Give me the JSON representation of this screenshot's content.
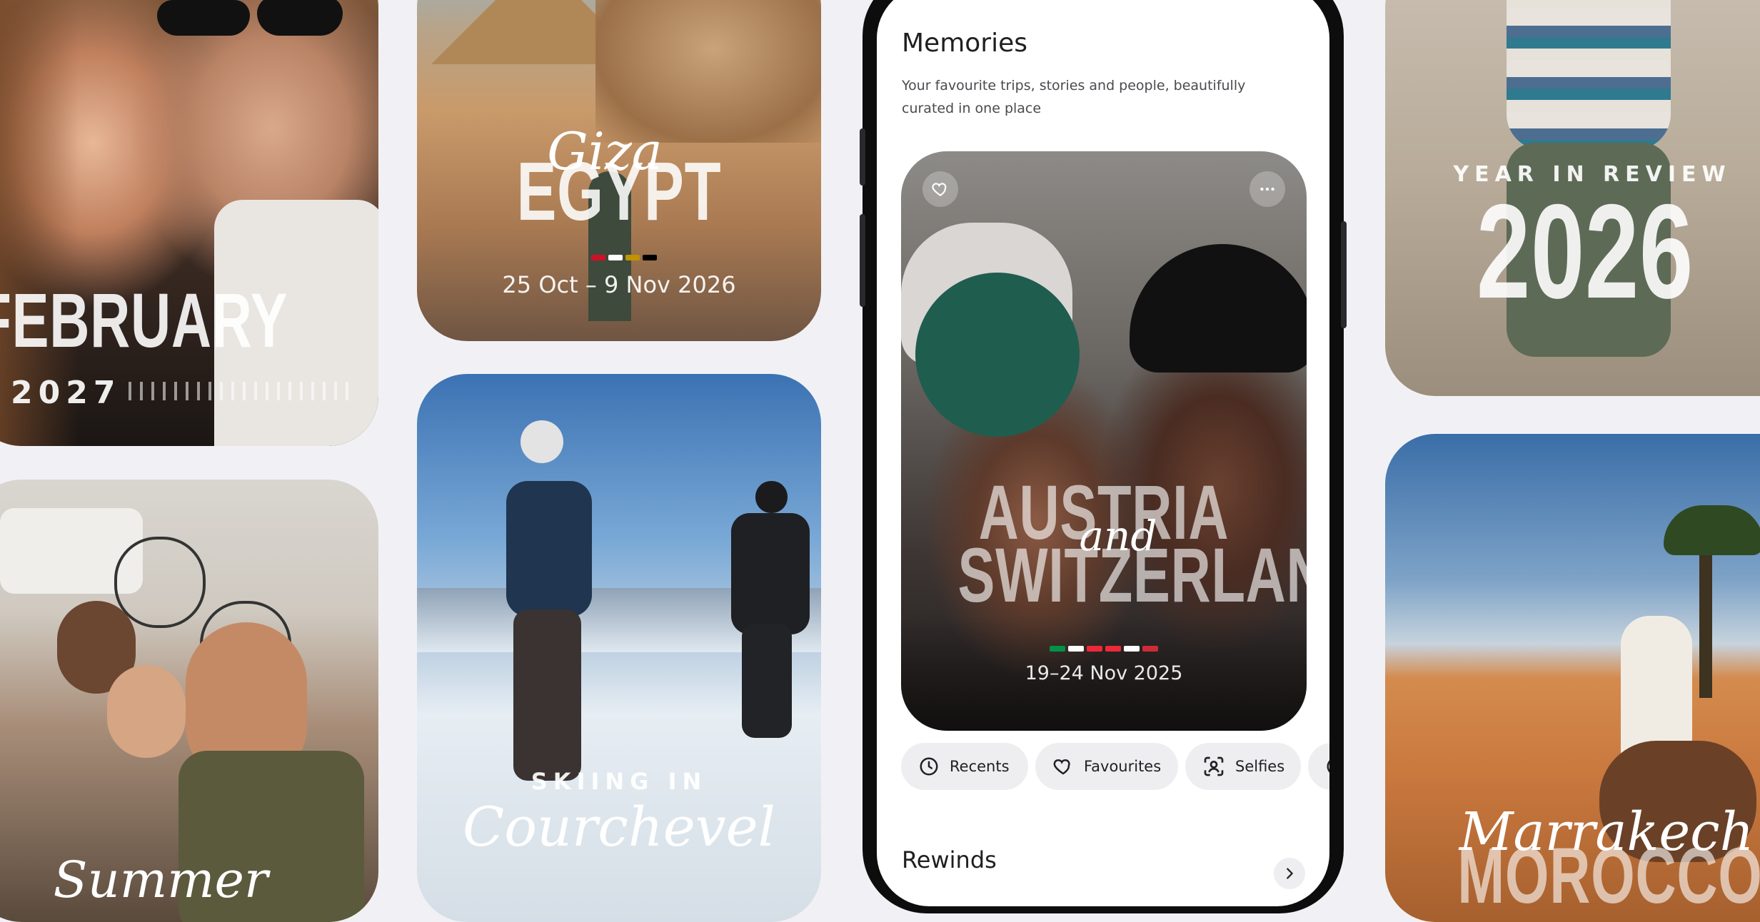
{
  "cards": {
    "february": {
      "month": "FEBRUARY",
      "year": "2027"
    },
    "egypt": {
      "script": "Giza",
      "title": "EGYPT",
      "dates": "25 Oct – 9 Nov 2026",
      "flag": [
        "#ce1126",
        "#ffffff",
        "#c09300",
        "#000000"
      ]
    },
    "family": {
      "script": "Summer"
    },
    "skiing": {
      "caps": "SKIING IN",
      "script": "Courchevel"
    },
    "review": {
      "caps": "YEAR IN REVIEW",
      "year": "2026"
    },
    "marrakech": {
      "script": "Marrakech",
      "title": "MOROCCO"
    }
  },
  "phone": {
    "title": "Memories",
    "subtitle": "Your favourite trips, stories and people, beautifully curated in one place",
    "featured": {
      "line1": "AUSTRIA",
      "connector": "and",
      "line2": "SWITZERLAND",
      "dates": "19–24 Nov 2025",
      "flag": [
        "#009246",
        "#ffffff",
        "#ed2939",
        "#ed2939",
        "#ffffff",
        "#ce2b37"
      ]
    },
    "chips": [
      {
        "label": "Recents",
        "icon": "clock-icon"
      },
      {
        "label": "Favourites",
        "icon": "heart-icon"
      },
      {
        "label": "Selfies",
        "icon": "selfie-icon"
      }
    ],
    "section": "Rewinds"
  }
}
